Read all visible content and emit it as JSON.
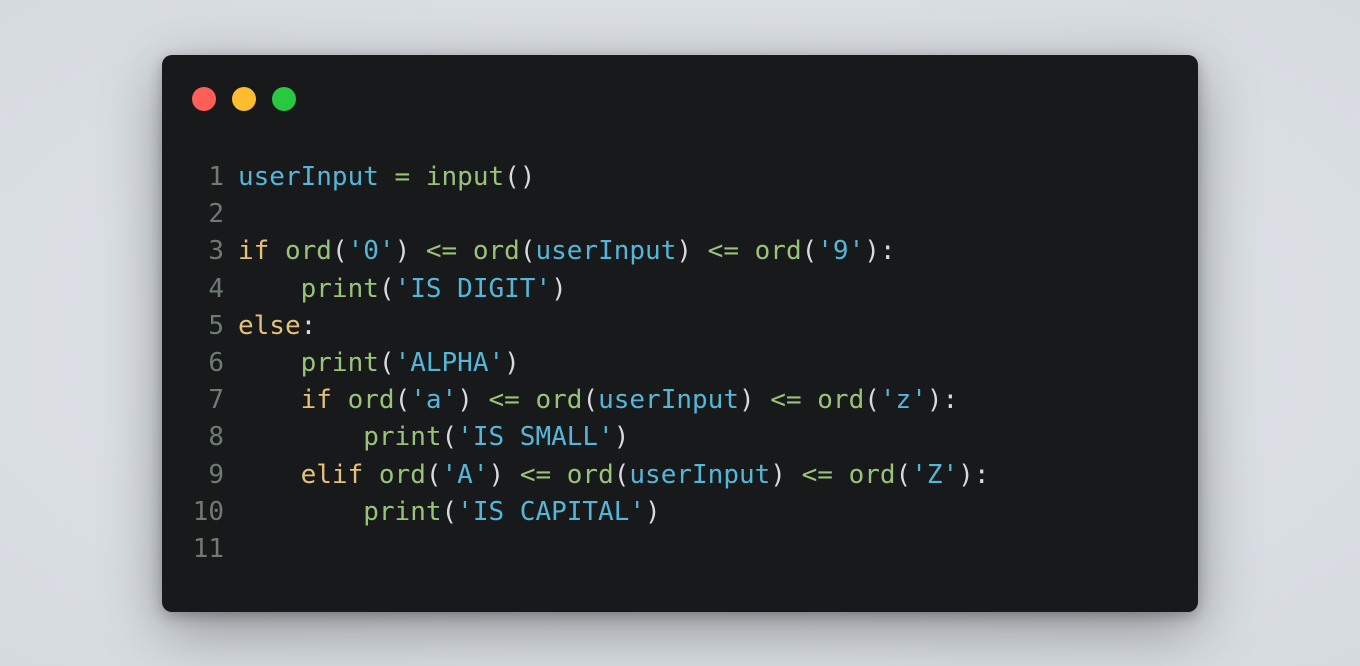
{
  "window": {
    "controls": [
      {
        "name": "close",
        "color": "#ff5f57"
      },
      {
        "name": "minimize",
        "color": "#febc2e"
      },
      {
        "name": "maximize",
        "color": "#28c840"
      }
    ]
  },
  "code": {
    "line_numbers": [
      "1",
      "2",
      "3",
      "4",
      "5",
      "6",
      "7",
      "8",
      "9",
      "10",
      "11"
    ],
    "lines": [
      [
        [
          "var",
          "userInput"
        ],
        [
          "p",
          " "
        ],
        [
          "op",
          "="
        ],
        [
          "p",
          " "
        ],
        [
          "fn",
          "input"
        ],
        [
          "p",
          "()"
        ]
      ],
      [],
      [
        [
          "kw",
          "if"
        ],
        [
          "p",
          " "
        ],
        [
          "fn",
          "ord"
        ],
        [
          "p",
          "("
        ],
        [
          "str",
          "'0'"
        ],
        [
          "p",
          ") "
        ],
        [
          "op",
          "<="
        ],
        [
          "p",
          " "
        ],
        [
          "fn",
          "ord"
        ],
        [
          "p",
          "("
        ],
        [
          "var",
          "userInput"
        ],
        [
          "p",
          ") "
        ],
        [
          "op",
          "<="
        ],
        [
          "p",
          " "
        ],
        [
          "fn",
          "ord"
        ],
        [
          "p",
          "("
        ],
        [
          "str",
          "'9'"
        ],
        [
          "p",
          "):"
        ]
      ],
      [
        [
          "p",
          "    "
        ],
        [
          "fn",
          "print"
        ],
        [
          "p",
          "("
        ],
        [
          "str",
          "'IS DIGIT'"
        ],
        [
          "p",
          ")"
        ]
      ],
      [
        [
          "kw",
          "else"
        ],
        [
          "p",
          ":"
        ]
      ],
      [
        [
          "p",
          "    "
        ],
        [
          "fn",
          "print"
        ],
        [
          "p",
          "("
        ],
        [
          "str",
          "'ALPHA'"
        ],
        [
          "p",
          ")"
        ]
      ],
      [
        [
          "p",
          "    "
        ],
        [
          "kw",
          "if"
        ],
        [
          "p",
          " "
        ],
        [
          "fn",
          "ord"
        ],
        [
          "p",
          "("
        ],
        [
          "str",
          "'a'"
        ],
        [
          "p",
          ") "
        ],
        [
          "op",
          "<="
        ],
        [
          "p",
          " "
        ],
        [
          "fn",
          "ord"
        ],
        [
          "p",
          "("
        ],
        [
          "var",
          "userInput"
        ],
        [
          "p",
          ") "
        ],
        [
          "op",
          "<="
        ],
        [
          "p",
          " "
        ],
        [
          "fn",
          "ord"
        ],
        [
          "p",
          "("
        ],
        [
          "str",
          "'z'"
        ],
        [
          "p",
          "):"
        ]
      ],
      [
        [
          "p",
          "        "
        ],
        [
          "fn",
          "print"
        ],
        [
          "p",
          "("
        ],
        [
          "str",
          "'IS SMALL'"
        ],
        [
          "p",
          ")"
        ]
      ],
      [
        [
          "p",
          "    "
        ],
        [
          "kw",
          "elif"
        ],
        [
          "p",
          " "
        ],
        [
          "fn",
          "ord"
        ],
        [
          "p",
          "("
        ],
        [
          "str",
          "'A'"
        ],
        [
          "p",
          ") "
        ],
        [
          "op",
          "<="
        ],
        [
          "p",
          " "
        ],
        [
          "fn",
          "ord"
        ],
        [
          "p",
          "("
        ],
        [
          "var",
          "userInput"
        ],
        [
          "p",
          ") "
        ],
        [
          "op",
          "<="
        ],
        [
          "p",
          " "
        ],
        [
          "fn",
          "ord"
        ],
        [
          "p",
          "("
        ],
        [
          "str",
          "'Z'"
        ],
        [
          "p",
          "):"
        ]
      ],
      [
        [
          "p",
          "        "
        ],
        [
          "fn",
          "print"
        ],
        [
          "p",
          "("
        ],
        [
          "str",
          "'IS CAPITAL'"
        ],
        [
          "p",
          ")"
        ]
      ],
      []
    ]
  }
}
